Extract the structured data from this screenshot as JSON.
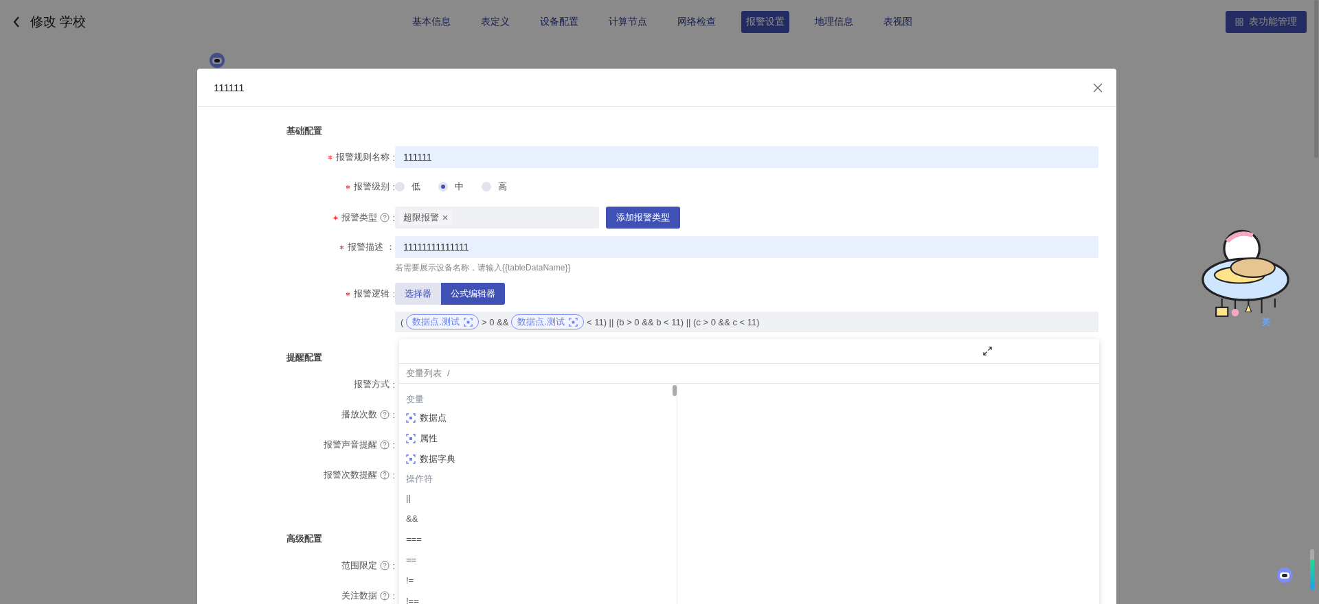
{
  "header": {
    "title": "修改 学校",
    "tabs": [
      {
        "label": "基本信息",
        "selected": false
      },
      {
        "label": "表定义",
        "selected": false
      },
      {
        "label": "设备配置",
        "selected": false
      },
      {
        "label": "计算节点",
        "selected": false
      },
      {
        "label": "网络检查",
        "selected": false
      },
      {
        "label": "报警设置",
        "selected": true
      },
      {
        "label": "地理信息",
        "selected": false
      },
      {
        "label": "表视图",
        "selected": false
      }
    ],
    "action": "表功能管理"
  },
  "dialog": {
    "title": "111111",
    "sections": [
      {
        "title": "基础配置",
        "fields": [
          {
            "kind": "input",
            "label": "报警规则名称",
            "suffix": ":",
            "required": true,
            "help": false,
            "value": "111111"
          },
          {
            "kind": "radio",
            "label": "报警级别",
            "suffix": ":",
            "required": true,
            "help": false,
            "options": [
              {
                "label": "低",
                "selected": false
              },
              {
                "label": "中",
                "selected": true
              },
              {
                "label": "高",
                "selected": false
              }
            ]
          },
          {
            "kind": "tags",
            "label": "报警类型",
            "suffix": ":",
            "required": true,
            "help": true,
            "tags": [
              "超限报警"
            ],
            "button": "添加报警类型"
          },
          {
            "kind": "input",
            "label": "报警描述",
            "suffix": "：",
            "required": true,
            "help": false,
            "value": "11111111111111",
            "hint": "若需要展示设备名称，请输入{{tableDataName}}"
          },
          {
            "kind": "logic",
            "label": "报警逻辑",
            "suffix": ":",
            "required": true,
            "help": false,
            "modes": [
              {
                "label": "选择器",
                "selected": false
              },
              {
                "label": "公式编辑器",
                "selected": true
              }
            ],
            "formula": [
              {
                "kind": "text",
                "text": "("
              },
              {
                "kind": "chip",
                "text": "数据点.测试"
              },
              {
                "kind": "text",
                "text": "> 0 &&"
              },
              {
                "kind": "chip",
                "text": "数据点.测试"
              },
              {
                "kind": "text",
                "text": "< 11) || (b > 0 && b < 11) || (c > 0 && c < 11)"
              }
            ]
          }
        ]
      },
      {
        "title": "提醒配置",
        "fields": [
          {
            "kind": "label",
            "label": "报警方式",
            "suffix": ":",
            "required": false,
            "help": false
          },
          {
            "kind": "label",
            "label": "播放次数",
            "suffix": ":",
            "required": false,
            "help": true
          },
          {
            "kind": "label",
            "label": "报警声音提醒",
            "suffix": ":",
            "required": false,
            "help": true
          },
          {
            "kind": "label",
            "label": "报警次数提醒",
            "suffix": ":",
            "required": false,
            "help": true
          }
        ]
      },
      {
        "title": "高级配置",
        "fields": [
          {
            "kind": "label",
            "label": "范围限定",
            "suffix": ":",
            "required": false,
            "help": true
          },
          {
            "kind": "label",
            "label": "关注数据",
            "suffix": ":",
            "required": false,
            "help": true
          }
        ]
      }
    ],
    "popover": {
      "breadcrumb": "变量列表",
      "separator": "/",
      "groups": [
        {
          "title": "变量",
          "items": [
            {
              "kind": "variable",
              "text": "数据点"
            },
            {
              "kind": "variable",
              "text": "属性"
            },
            {
              "kind": "variable",
              "text": "数据字典"
            }
          ]
        },
        {
          "title": "操作符",
          "items": [
            {
              "kind": "operator",
              "text": "||"
            },
            {
              "kind": "operator",
              "text": "&&"
            },
            {
              "kind": "operator",
              "text": "==="
            },
            {
              "kind": "operator",
              "text": "=="
            },
            {
              "kind": "operator",
              "text": "!="
            },
            {
              "kind": "operator",
              "text": "!=="
            }
          ]
        }
      ]
    }
  },
  "ime": {
    "mode": "英"
  }
}
